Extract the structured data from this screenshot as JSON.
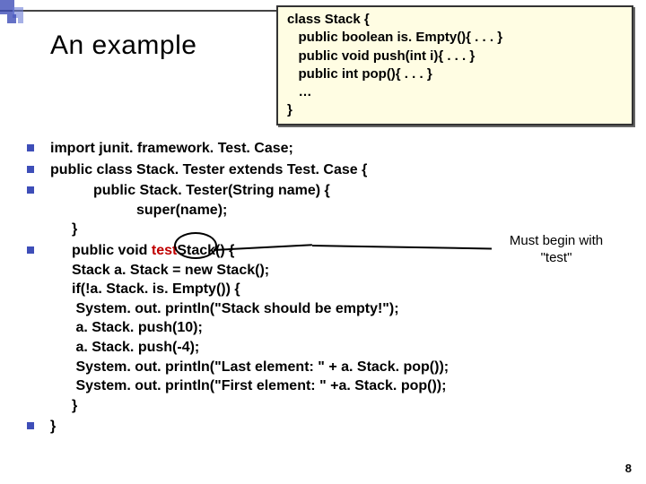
{
  "title": "An example",
  "codebox": {
    "l1": "class Stack {",
    "l2": "   public boolean is. Empty(){ . . . }",
    "l3": "   public void push(int i){ . . . }",
    "l4": "   public int pop(){ . . . }",
    "l5": "   …",
    "l6": "}"
  },
  "bullets": {
    "b1": "import junit. framework. Test. Case;",
    "b2": "public class Stack. Tester extends Test. Case {",
    "b3_l1": "public Stack. Tester(String name) {",
    "b3_l2": "super(name);",
    "b3_l3": "}",
    "b4_pre": "public void ",
    "b4_red": "test",
    "b4_post": "Stack() {",
    "b4_l2": "Stack a. Stack = new Stack();",
    "b4_l3": "if(!a. Stack. is. Empty()) {",
    "b4_l4": " System. out. println(\"Stack should be empty!\");",
    "b4_l5": " a. Stack. push(10);",
    "b4_l6": " a. Stack. push(-4);",
    "b4_l7": " System. out. println(\"Last element: \" + a. Stack. pop());",
    "b4_l8": " System. out. println(\"First element: \" +a. Stack. pop());",
    "b4_l9": "}",
    "b5": "}"
  },
  "annotation": {
    "line1": "Must begin with",
    "line2": "\"test\""
  },
  "page_number": "8"
}
